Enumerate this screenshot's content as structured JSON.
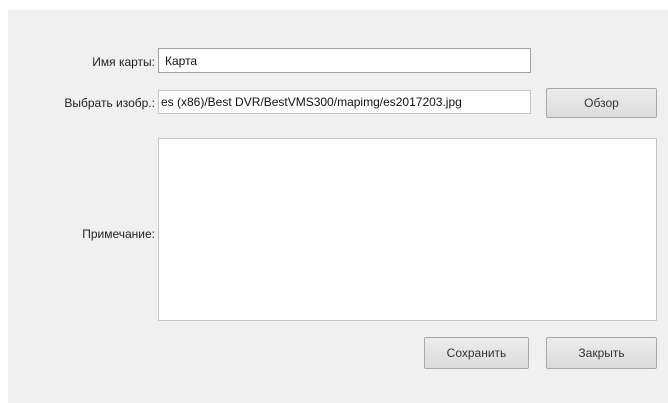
{
  "form": {
    "map_name_label": "Имя карты:",
    "map_name_value": "Карта",
    "select_image_label": "Выбрать изобр.:",
    "image_path_value": "es (x86)/Best DVR/BestVMS300/mapimg/es2017203.jpg",
    "browse_button_label": "Обзор",
    "note_label": "Примечание:",
    "note_value": ""
  },
  "footer": {
    "save_label": "Сохранить",
    "close_label": "Закрыть"
  }
}
